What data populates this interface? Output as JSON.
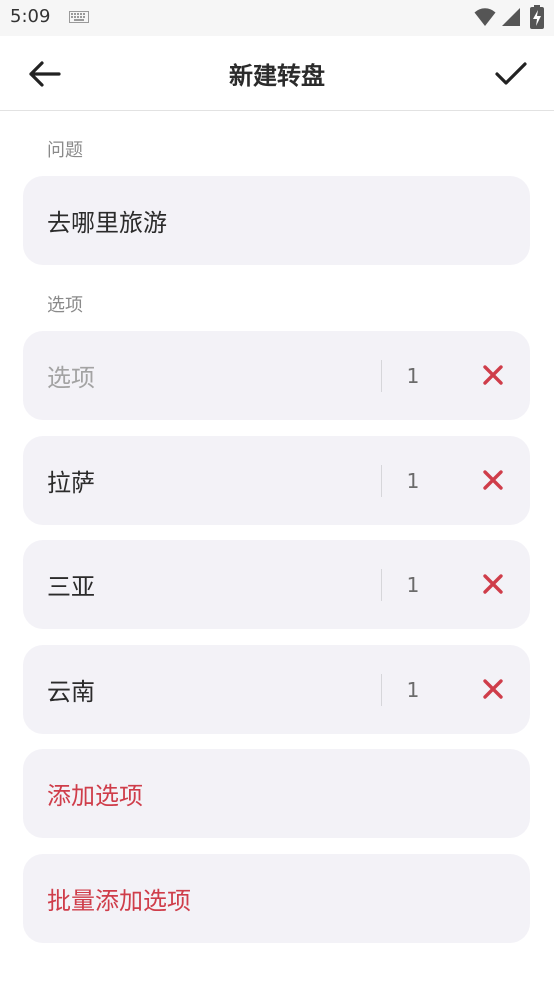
{
  "status_bar": {
    "time": "5:09",
    "icons": [
      "keyboard-icon",
      "wifi-icon",
      "signal-icon",
      "battery-charging-icon"
    ]
  },
  "app_bar": {
    "title": "新建转盘",
    "back_icon": "arrow-left-icon",
    "confirm_icon": "check-icon"
  },
  "question": {
    "label": "问题",
    "value": "去哪里旅游"
  },
  "options": {
    "label": "选项",
    "items": [
      {
        "text": "",
        "placeholder": "选项",
        "weight": "1"
      },
      {
        "text": "拉萨",
        "weight": "1"
      },
      {
        "text": "三亚",
        "weight": "1"
      },
      {
        "text": "云南",
        "weight": "1"
      }
    ],
    "delete_icon": "close-icon"
  },
  "actions": {
    "add_option": "添加选项",
    "batch_add_option": "批量添加选项"
  },
  "colors": {
    "accent": "#cf3d4a",
    "card_bg": "#f3f2f7",
    "label_gray": "#8a8a8a"
  }
}
